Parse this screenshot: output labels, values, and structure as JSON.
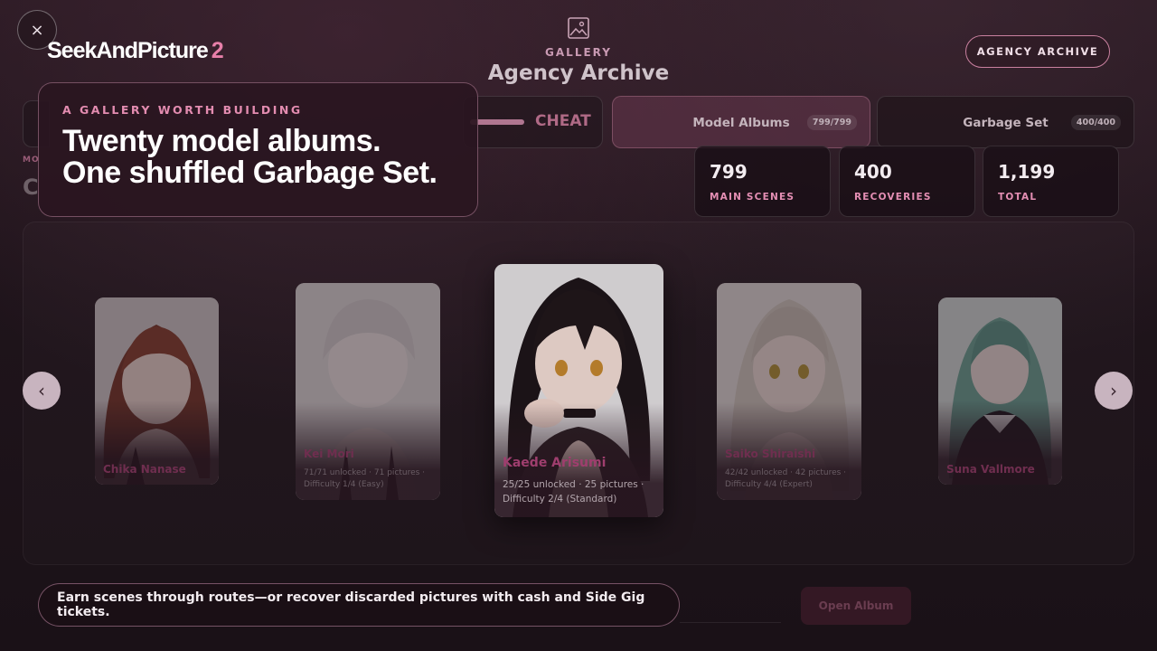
{
  "header": {
    "close_label": "×",
    "logo_text": "SeekAndPicture",
    "logo_number": "2",
    "kicker": "GALLERY",
    "title": "Agency Archive",
    "archive_button": "AGENCY ARCHIVE"
  },
  "toolbar": {
    "cheat_label": "CHEAT",
    "tabs": [
      {
        "label": "Model Albums",
        "count": "799/799",
        "active": true
      },
      {
        "label": "Garbage Set",
        "count": "400/400",
        "active": false
      }
    ]
  },
  "stats": [
    {
      "value": "799",
      "label": "MAIN SCENES"
    },
    {
      "value": "400",
      "label": "RECOVERIES"
    },
    {
      "value": "1,199",
      "label": "TOTAL"
    }
  ],
  "intro": {
    "kicker": "A GALLERY WORTH BUILDING",
    "title_line1": "Twenty model albums.",
    "title_line2": "One shuffled Garbage Set."
  },
  "ghost": {
    "section_kicker": "MO",
    "section_title": "C"
  },
  "carousel": {
    "prev_icon": "chevron-left-icon",
    "next_icon": "chevron-right-icon",
    "cards": [
      {
        "name": "Chika Nanase",
        "line1": "",
        "line2": ""
      },
      {
        "name": "Kei Mori",
        "line1": "71/71 unlocked · 71 pictures ·",
        "line2": "Difficulty 1/4 (Easy)"
      },
      {
        "name": "Kaede Arisumi",
        "line1": "25/25 unlocked · 25 pictures ·",
        "line2": "Difficulty 2/4 (Standard)"
      },
      {
        "name": "Saiko Shiraishi",
        "line1": "42/42 unlocked · 42 pictures ·",
        "line2": "Difficulty 4/4 (Expert)"
      },
      {
        "name": "Suna Vallmore",
        "line1": "",
        "line2": ""
      }
    ]
  },
  "footer": {
    "tip": "Earn scenes through routes—or recover discarded pictures with cash and Side Gig tickets.",
    "open_button": "Open Album"
  },
  "colors": {
    "accent_pink": "#e77fa9",
    "name_pink": "#b1457a",
    "background": "#1f141b"
  }
}
